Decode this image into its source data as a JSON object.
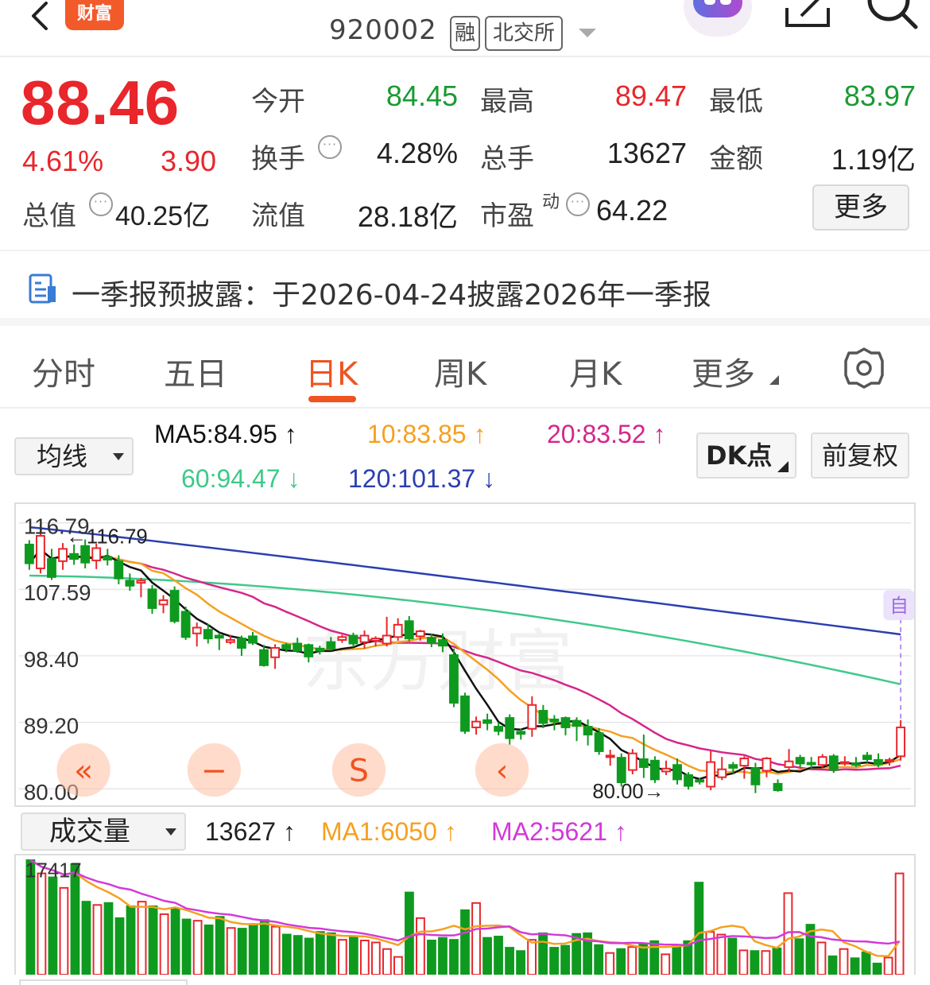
{
  "app": {
    "brand_label": "财富"
  },
  "header": {
    "stock_code": "920002",
    "tag_margin": "融",
    "tag_exchange": "北交所"
  },
  "quote": {
    "price": "88.46",
    "change_pct": "4.61%",
    "change_abs": "3.90",
    "market_cap_label": "总值",
    "market_cap_value": "40.25亿",
    "fields": {
      "open_label": "今开",
      "open_value": "84.45",
      "high_label": "最高",
      "high_value": "89.47",
      "low_label": "最低",
      "low_value": "83.97",
      "turnover_label": "换手",
      "turnover_value": "4.28%",
      "volume_label": "总手",
      "volume_value": "13627",
      "amount_label": "金额",
      "amount_value": "1.19亿",
      "float_cap_label": "流值",
      "float_cap_value": "28.18亿",
      "pe_label": "市盈",
      "pe_sup": "动",
      "pe_value": "64.22"
    },
    "more_button": "更多"
  },
  "notice": {
    "text": "一季报预披露：于2026-04-24披露2026年一季报"
  },
  "tabs": [
    {
      "label": "分时",
      "active": false
    },
    {
      "label": "五日",
      "active": false
    },
    {
      "label": "日K",
      "active": true
    },
    {
      "label": "周K",
      "active": false
    },
    {
      "label": "月K",
      "active": false
    },
    {
      "label": "更多",
      "active": false
    }
  ],
  "ma_bar": {
    "selector": "均线",
    "ma5": "MA5:84.95 ↑",
    "ma10": "10:83.85 ↑",
    "ma20": "20:83.52 ↑",
    "ma60": "60:94.47 ↓",
    "ma120": "120:101.37 ↓",
    "dk_button": "DK点",
    "adjust_button": "前复权",
    "colors": {
      "ma5": "#111111",
      "ma10": "#f5a020",
      "ma20": "#d6258a",
      "ma60": "#3fc98a",
      "ma120": "#2a3fb0"
    }
  },
  "kline": {
    "axis_labels": [
      "116.79",
      "107.59",
      "98.40",
      "89.20",
      "80.00"
    ],
    "max_marker": "116.79",
    "min_marker": "80.00",
    "last_marker": "自",
    "controls": [
      "«",
      "−",
      "S",
      "‹"
    ]
  },
  "volume_bar": {
    "selector": "成交量",
    "vol": "13627 ↑",
    "ma1": "MA1:6050 ↑",
    "ma2": "MA2:5621 ↑",
    "max_label": "17417",
    "colors": {
      "ma1": "#f5a020",
      "ma2": "#d23ad8"
    }
  },
  "chart_data": {
    "type": "candlestick",
    "ylim": [
      80.0,
      116.79
    ],
    "candles_ohlc": [
      [
        113.8,
        111.2,
        114.4,
        110.3
      ],
      [
        110.5,
        115.0,
        116.5,
        109.8
      ],
      [
        111.8,
        109.3,
        113.2,
        108.9
      ],
      [
        111.5,
        113.2,
        114.0,
        110.3
      ],
      [
        112.5,
        111.8,
        113.8,
        111.0
      ],
      [
        113.6,
        111.3,
        114.5,
        110.5
      ],
      [
        111.6,
        113.3,
        113.9,
        110.4
      ],
      [
        112.1,
        111.7,
        113.2,
        110.9
      ],
      [
        111.5,
        109.1,
        112.3,
        108.3
      ],
      [
        108.8,
        108.1,
        109.8,
        107.4
      ],
      [
        108.5,
        108.8,
        109.2,
        106.5
      ],
      [
        107.6,
        105.0,
        108.2,
        104.2
      ],
      [
        105.5,
        106.1,
        106.8,
        104.3
      ],
      [
        107.4,
        103.2,
        108.0,
        102.9
      ],
      [
        104.5,
        101.0,
        105.2,
        100.6
      ],
      [
        101.5,
        102.3,
        103.0,
        99.7
      ],
      [
        102.0,
        100.8,
        102.8,
        100.1
      ],
      [
        101.2,
        100.9,
        101.6,
        99.2
      ],
      [
        100.3,
        100.6,
        101.3,
        100.0
      ],
      [
        100.8,
        99.5,
        101.2,
        98.4
      ],
      [
        101.1,
        100.2,
        101.7,
        99.9
      ],
      [
        99.2,
        97.1,
        99.9,
        96.9
      ],
      [
        98.2,
        99.5,
        100.0,
        96.6
      ],
      [
        99.9,
        99.4,
        100.2,
        98.9
      ],
      [
        100.1,
        99.1,
        100.9,
        98.8
      ],
      [
        99.9,
        98.3,
        100.1,
        97.5
      ],
      [
        99.4,
        99.1,
        99.8,
        98.6
      ],
      [
        100.3,
        99.4,
        101.0,
        99.1
      ],
      [
        100.6,
        101.0,
        101.3,
        100.2
      ],
      [
        101.2,
        100.1,
        101.6,
        99.6
      ],
      [
        100.3,
        101.2,
        101.9,
        99.4
      ],
      [
        100.5,
        100.8,
        101.1,
        99.7
      ],
      [
        100.1,
        101.2,
        103.8,
        99.7
      ],
      [
        101.0,
        102.7,
        103.6,
        100.5
      ],
      [
        103.2,
        100.8,
        103.9,
        100.4
      ],
      [
        101.1,
        101.8,
        102.0,
        100.5
      ],
      [
        100.9,
        100.2,
        101.5,
        99.6
      ],
      [
        100.6,
        99.8,
        101.5,
        98.9
      ],
      [
        98.5,
        91.9,
        99.4,
        91.3
      ],
      [
        92.8,
        88.0,
        93.3,
        87.6
      ],
      [
        88.5,
        89.3,
        90.0,
        87.5
      ],
      [
        89.5,
        89.1,
        90.4,
        88.1
      ],
      [
        88.6,
        88.0,
        89.2,
        87.4
      ],
      [
        89.8,
        87.0,
        90.3,
        86.1
      ],
      [
        87.9,
        87.6,
        88.3,
        86.8
      ],
      [
        88.3,
        91.6,
        92.8,
        87.2
      ],
      [
        90.8,
        89.1,
        91.6,
        88.4
      ],
      [
        89.6,
        89.3,
        90.2,
        88.1
      ],
      [
        89.8,
        88.5,
        90.0,
        87.4
      ],
      [
        89.4,
        88.7,
        89.9,
        86.6
      ],
      [
        88.6,
        87.5,
        89.6,
        86.0
      ],
      [
        87.7,
        85.2,
        88.4,
        84.7
      ],
      [
        84.5,
        84.6,
        85.4,
        83.2
      ],
      [
        84.3,
        80.9,
        84.9,
        80.3
      ],
      [
        82.6,
        84.9,
        85.5,
        82.0
      ],
      [
        84.1,
        83.0,
        87.5,
        81.5
      ],
      [
        83.9,
        81.3,
        84.5,
        80.8
      ],
      [
        82.4,
        82.8,
        83.9,
        81.9
      ],
      [
        83.3,
        81.3,
        84.2,
        80.6
      ],
      [
        81.9,
        80.4,
        82.3,
        79.9
      ],
      [
        81.2,
        81.0,
        81.5,
        80.6
      ],
      [
        80.3,
        83.7,
        85.2,
        79.8
      ],
      [
        81.6,
        82.7,
        84.4,
        81.2
      ],
      [
        83.3,
        82.9,
        83.7,
        82.1
      ],
      [
        83.2,
        84.2,
        84.5,
        81.4
      ],
      [
        82.8,
        80.6,
        83.6,
        79.4
      ],
      [
        82.5,
        84.2,
        84.4,
        81.6
      ],
      [
        80.7,
        79.8,
        81.3,
        79.6
      ],
      [
        83.0,
        83.8,
        85.5,
        82.4
      ],
      [
        84.3,
        83.5,
        84.7,
        82.9
      ],
      [
        83.6,
        83.4,
        84.4,
        82.7
      ],
      [
        83.3,
        84.4,
        84.8,
        82.9
      ],
      [
        84.5,
        82.6,
        84.8,
        82.2
      ],
      [
        83.6,
        83.7,
        84.5,
        83.2
      ],
      [
        83.5,
        83.4,
        84.4,
        83.0
      ],
      [
        84.6,
        84.1,
        85.1,
        83.6
      ],
      [
        84.0,
        83.4,
        84.9,
        83.0
      ],
      [
        83.9,
        84.0,
        84.3,
        83.2
      ],
      [
        84.5,
        88.5,
        89.5,
        83.9
      ]
    ],
    "ma_lines": {
      "MA5": "84.95",
      "MA10": "83.85",
      "MA20": "83.52",
      "MA60": "94.47",
      "MA120": "101.37"
    },
    "volumes": [
      17417,
      15400,
      14800,
      13200,
      16800,
      11100,
      10600,
      10900,
      8600,
      10400,
      11100,
      10400,
      9200,
      10000,
      8400,
      8200,
      7500,
      8800,
      7100,
      7000,
      7700,
      8300,
      7300,
      6100,
      5900,
      5500,
      6500,
      6300,
      5300,
      5800,
      5200,
      4900,
      3900,
      2700,
      12500,
      8600,
      5200,
      5600,
      5300,
      9800,
      10900,
      5600,
      5800,
      4100,
      3600,
      5300,
      6300,
      4100,
      4400,
      6200,
      6300,
      4500,
      3300,
      3900,
      4200,
      4700,
      5100,
      3100,
      4400,
      5100,
      14000,
      6500,
      6100,
      5500,
      3700,
      3600,
      3600,
      4000,
      12400,
      5400,
      7600,
      4900,
      2800,
      3900,
      2500,
      3400,
      1700,
      2600,
      15400
    ],
    "vol_ma1": "6050",
    "vol_ma2": "5621"
  }
}
